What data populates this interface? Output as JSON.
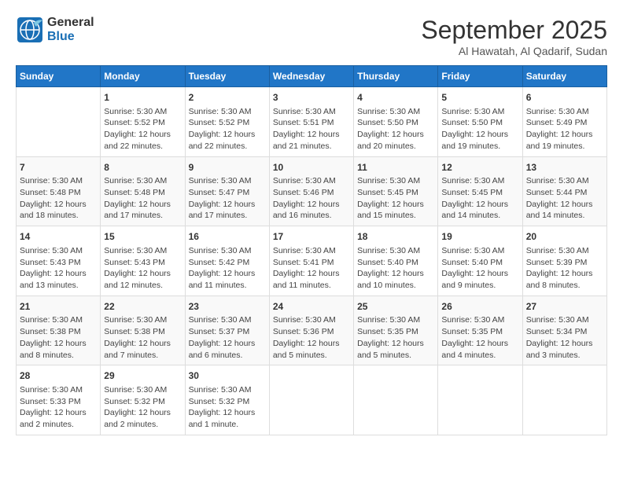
{
  "header": {
    "logo_line1": "General",
    "logo_line2": "Blue",
    "main_title": "September 2025",
    "subtitle": "Al Hawatah, Al Qadarif, Sudan"
  },
  "days_of_week": [
    "Sunday",
    "Monday",
    "Tuesday",
    "Wednesday",
    "Thursday",
    "Friday",
    "Saturday"
  ],
  "weeks": [
    [
      {
        "day": "",
        "content": ""
      },
      {
        "day": "1",
        "content": "Sunrise: 5:30 AM\nSunset: 5:52 PM\nDaylight: 12 hours\nand 22 minutes."
      },
      {
        "day": "2",
        "content": "Sunrise: 5:30 AM\nSunset: 5:52 PM\nDaylight: 12 hours\nand 22 minutes."
      },
      {
        "day": "3",
        "content": "Sunrise: 5:30 AM\nSunset: 5:51 PM\nDaylight: 12 hours\nand 21 minutes."
      },
      {
        "day": "4",
        "content": "Sunrise: 5:30 AM\nSunset: 5:50 PM\nDaylight: 12 hours\nand 20 minutes."
      },
      {
        "day": "5",
        "content": "Sunrise: 5:30 AM\nSunset: 5:50 PM\nDaylight: 12 hours\nand 19 minutes."
      },
      {
        "day": "6",
        "content": "Sunrise: 5:30 AM\nSunset: 5:49 PM\nDaylight: 12 hours\nand 19 minutes."
      }
    ],
    [
      {
        "day": "7",
        "content": "Sunrise: 5:30 AM\nSunset: 5:48 PM\nDaylight: 12 hours\nand 18 minutes."
      },
      {
        "day": "8",
        "content": "Sunrise: 5:30 AM\nSunset: 5:48 PM\nDaylight: 12 hours\nand 17 minutes."
      },
      {
        "day": "9",
        "content": "Sunrise: 5:30 AM\nSunset: 5:47 PM\nDaylight: 12 hours\nand 17 minutes."
      },
      {
        "day": "10",
        "content": "Sunrise: 5:30 AM\nSunset: 5:46 PM\nDaylight: 12 hours\nand 16 minutes."
      },
      {
        "day": "11",
        "content": "Sunrise: 5:30 AM\nSunset: 5:45 PM\nDaylight: 12 hours\nand 15 minutes."
      },
      {
        "day": "12",
        "content": "Sunrise: 5:30 AM\nSunset: 5:45 PM\nDaylight: 12 hours\nand 14 minutes."
      },
      {
        "day": "13",
        "content": "Sunrise: 5:30 AM\nSunset: 5:44 PM\nDaylight: 12 hours\nand 14 minutes."
      }
    ],
    [
      {
        "day": "14",
        "content": "Sunrise: 5:30 AM\nSunset: 5:43 PM\nDaylight: 12 hours\nand 13 minutes."
      },
      {
        "day": "15",
        "content": "Sunrise: 5:30 AM\nSunset: 5:43 PM\nDaylight: 12 hours\nand 12 minutes."
      },
      {
        "day": "16",
        "content": "Sunrise: 5:30 AM\nSunset: 5:42 PM\nDaylight: 12 hours\nand 11 minutes."
      },
      {
        "day": "17",
        "content": "Sunrise: 5:30 AM\nSunset: 5:41 PM\nDaylight: 12 hours\nand 11 minutes."
      },
      {
        "day": "18",
        "content": "Sunrise: 5:30 AM\nSunset: 5:40 PM\nDaylight: 12 hours\nand 10 minutes."
      },
      {
        "day": "19",
        "content": "Sunrise: 5:30 AM\nSunset: 5:40 PM\nDaylight: 12 hours\nand 9 minutes."
      },
      {
        "day": "20",
        "content": "Sunrise: 5:30 AM\nSunset: 5:39 PM\nDaylight: 12 hours\nand 8 minutes."
      }
    ],
    [
      {
        "day": "21",
        "content": "Sunrise: 5:30 AM\nSunset: 5:38 PM\nDaylight: 12 hours\nand 8 minutes."
      },
      {
        "day": "22",
        "content": "Sunrise: 5:30 AM\nSunset: 5:38 PM\nDaylight: 12 hours\nand 7 minutes."
      },
      {
        "day": "23",
        "content": "Sunrise: 5:30 AM\nSunset: 5:37 PM\nDaylight: 12 hours\nand 6 minutes."
      },
      {
        "day": "24",
        "content": "Sunrise: 5:30 AM\nSunset: 5:36 PM\nDaylight: 12 hours\nand 5 minutes."
      },
      {
        "day": "25",
        "content": "Sunrise: 5:30 AM\nSunset: 5:35 PM\nDaylight: 12 hours\nand 5 minutes."
      },
      {
        "day": "26",
        "content": "Sunrise: 5:30 AM\nSunset: 5:35 PM\nDaylight: 12 hours\nand 4 minutes."
      },
      {
        "day": "27",
        "content": "Sunrise: 5:30 AM\nSunset: 5:34 PM\nDaylight: 12 hours\nand 3 minutes."
      }
    ],
    [
      {
        "day": "28",
        "content": "Sunrise: 5:30 AM\nSunset: 5:33 PM\nDaylight: 12 hours\nand 2 minutes."
      },
      {
        "day": "29",
        "content": "Sunrise: 5:30 AM\nSunset: 5:32 PM\nDaylight: 12 hours\nand 2 minutes."
      },
      {
        "day": "30",
        "content": "Sunrise: 5:30 AM\nSunset: 5:32 PM\nDaylight: 12 hours\nand 1 minute."
      },
      {
        "day": "",
        "content": ""
      },
      {
        "day": "",
        "content": ""
      },
      {
        "day": "",
        "content": ""
      },
      {
        "day": "",
        "content": ""
      }
    ]
  ]
}
